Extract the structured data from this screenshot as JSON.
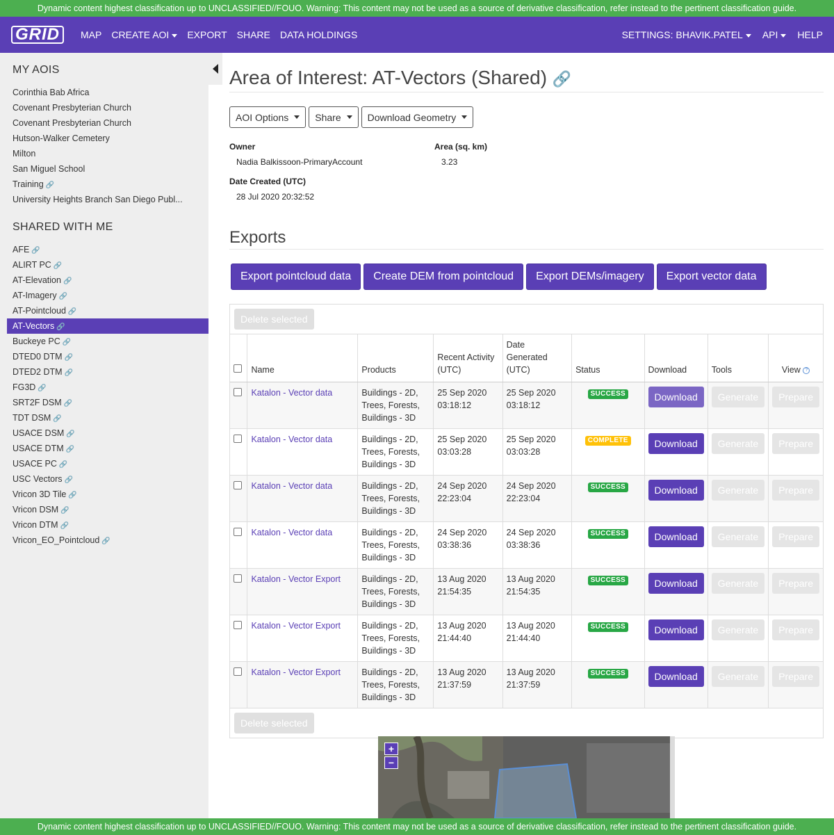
{
  "classification": "Dynamic content highest classification up to UNCLASSIFIED//FOUO. Warning: This content may not be used as a source of derivative classification, refer instead to the pertinent classification guide.",
  "nav": {
    "logo": "GRID",
    "items": [
      "MAP",
      "CREATE AOI",
      "EXPORT",
      "SHARE",
      "DATA HOLDINGS"
    ],
    "settings": "SETTINGS: BHAVIK.PATEL",
    "api": "API",
    "help": "HELP"
  },
  "sidebar": {
    "my_aois_title": "MY AOIS",
    "my_aois": [
      {
        "label": "Corinthia Bab Africa",
        "link": false
      },
      {
        "label": "Covenant Presbyterian Church",
        "link": false
      },
      {
        "label": "Covenant Presbyterian Church",
        "link": false
      },
      {
        "label": "Hutson-Walker Cemetery",
        "link": false
      },
      {
        "label": "Milton",
        "link": false
      },
      {
        "label": "San Miguel School",
        "link": false
      },
      {
        "label": "Training",
        "link": true
      },
      {
        "label": "University Heights Branch San Diego Publ...",
        "link": false
      }
    ],
    "shared_title": "SHARED WITH ME",
    "shared": [
      {
        "label": "AFE",
        "active": false
      },
      {
        "label": "ALIRT PC",
        "active": false
      },
      {
        "label": "AT-Elevation",
        "active": false
      },
      {
        "label": "AT-Imagery",
        "active": false
      },
      {
        "label": "AT-Pointcloud",
        "active": false
      },
      {
        "label": "AT-Vectors",
        "active": true
      },
      {
        "label": "Buckeye PC",
        "active": false
      },
      {
        "label": "DTED0 DTM",
        "active": false
      },
      {
        "label": "DTED2 DTM",
        "active": false
      },
      {
        "label": "FG3D",
        "active": false
      },
      {
        "label": "SRT2F DSM",
        "active": false
      },
      {
        "label": "TDT DSM",
        "active": false
      },
      {
        "label": "USACE DSM",
        "active": false
      },
      {
        "label": "USACE DTM",
        "active": false
      },
      {
        "label": "USACE PC",
        "active": false
      },
      {
        "label": "USC Vectors",
        "active": false
      },
      {
        "label": "Vricon 3D Tile",
        "active": false
      },
      {
        "label": "Vricon DSM",
        "active": false
      },
      {
        "label": "Vricon DTM",
        "active": false
      },
      {
        "label": "Vricon_EO_Pointcloud",
        "active": false
      }
    ]
  },
  "aoi": {
    "title": "Area of Interest: AT-Vectors (Shared)",
    "options_btn": "AOI Options",
    "share_btn": "Share",
    "download_geom_btn": "Download Geometry",
    "owner_label": "Owner",
    "owner": "Nadia Balkissoon-PrimaryAccount",
    "area_label": "Area (sq. km)",
    "area": "3.23",
    "date_label": "Date Created (UTC)",
    "date": "28 Jul 2020 20:32:52"
  },
  "exports": {
    "title": "Exports",
    "buttons": [
      "Export pointcloud data",
      "Create DEM from pointcloud",
      "Export DEMs/imagery",
      "Export vector data"
    ],
    "delete_label": "Delete selected",
    "columns": {
      "name": "Name",
      "products": "Products",
      "recent": "Recent Activity (UTC)",
      "generated": "Date Generated (UTC)",
      "status": "Status",
      "download": "Download",
      "tools": "Tools",
      "view": "View"
    },
    "rows": [
      {
        "name": "Katalon - Vector data",
        "products": "Buildings - 2D, Trees, Forests, Buildings - 3D",
        "recent_d": "25 Sep 2020",
        "recent_t": "03:18:12",
        "gen_d": "25 Sep 2020",
        "gen_t": "03:18:12",
        "status": "SUCCESS"
      },
      {
        "name": "Katalon - Vector data",
        "products": "Buildings - 2D, Trees, Forests, Buildings - 3D",
        "recent_d": "25 Sep 2020",
        "recent_t": "03:03:28",
        "gen_d": "25 Sep 2020",
        "gen_t": "03:03:28",
        "status": "COMPLETE"
      },
      {
        "name": "Katalon - Vector data",
        "products": "Buildings - 2D, Trees, Forests, Buildings - 3D",
        "recent_d": "24 Sep 2020",
        "recent_t": "22:23:04",
        "gen_d": "24 Sep 2020",
        "gen_t": "22:23:04",
        "status": "SUCCESS"
      },
      {
        "name": "Katalon - Vector data",
        "products": "Buildings - 2D, Trees, Forests, Buildings - 3D",
        "recent_d": "24 Sep 2020",
        "recent_t": "03:38:36",
        "gen_d": "24 Sep 2020",
        "gen_t": "03:38:36",
        "status": "SUCCESS"
      },
      {
        "name": "Katalon - Vector Export",
        "products": "Buildings - 2D, Trees, Forests, Buildings - 3D",
        "recent_d": "13 Aug 2020",
        "recent_t": "21:54:35",
        "gen_d": "13 Aug 2020",
        "gen_t": "21:54:35",
        "status": "SUCCESS"
      },
      {
        "name": "Katalon - Vector Export",
        "products": "Buildings - 2D, Trees, Forests, Buildings - 3D",
        "recent_d": "13 Aug 2020",
        "recent_t": "21:44:40",
        "gen_d": "13 Aug 2020",
        "gen_t": "21:44:40",
        "status": "SUCCESS"
      },
      {
        "name": "Katalon - Vector Export",
        "products": "Buildings - 2D, Trees, Forests, Buildings - 3D",
        "recent_d": "13 Aug 2020",
        "recent_t": "21:37:59",
        "gen_d": "13 Aug 2020",
        "gen_t": "21:37:59",
        "status": "SUCCESS"
      }
    ],
    "download_label": "Download",
    "generate_label": "Generate",
    "prepare_label": "Prepare"
  },
  "map": {
    "zoom_in": "+",
    "zoom_out": "−"
  },
  "colors": {
    "brand": "#5a3fb5",
    "classification": "#4caf50",
    "success": "#28a745",
    "complete": "#ffc107"
  }
}
